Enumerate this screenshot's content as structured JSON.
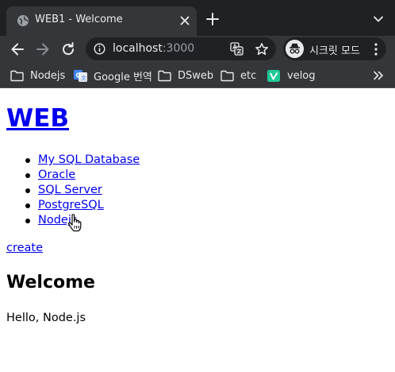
{
  "browser": {
    "tab_title": "WEB1 - Welcome",
    "url_host": "localhost",
    "url_port": ":3000",
    "incognito_label": "시크릿 모드",
    "bookmarks": [
      {
        "label": "Nodejs",
        "icon": "folder-icon"
      },
      {
        "label": "Google 번역",
        "icon": "google-translate-icon"
      },
      {
        "label": "DSweb",
        "icon": "folder-icon"
      },
      {
        "label": "etc",
        "icon": "folder-icon"
      },
      {
        "label": "velog",
        "icon": "velog-icon"
      }
    ],
    "colors": {
      "frame": "#202124",
      "toolbar": "#35363a",
      "text": "#e8eaed",
      "velog": "#20c997",
      "google_translate": "#4285f4"
    }
  },
  "page": {
    "title": "WEB",
    "nav_items": [
      "My SQL Database",
      "Oracle",
      "SQL Server",
      "PostgreSQL",
      "Nodejs"
    ],
    "create_label": "create",
    "heading": "Welcome",
    "body": "Hello, Node.js",
    "link_color": "#0000ee"
  }
}
